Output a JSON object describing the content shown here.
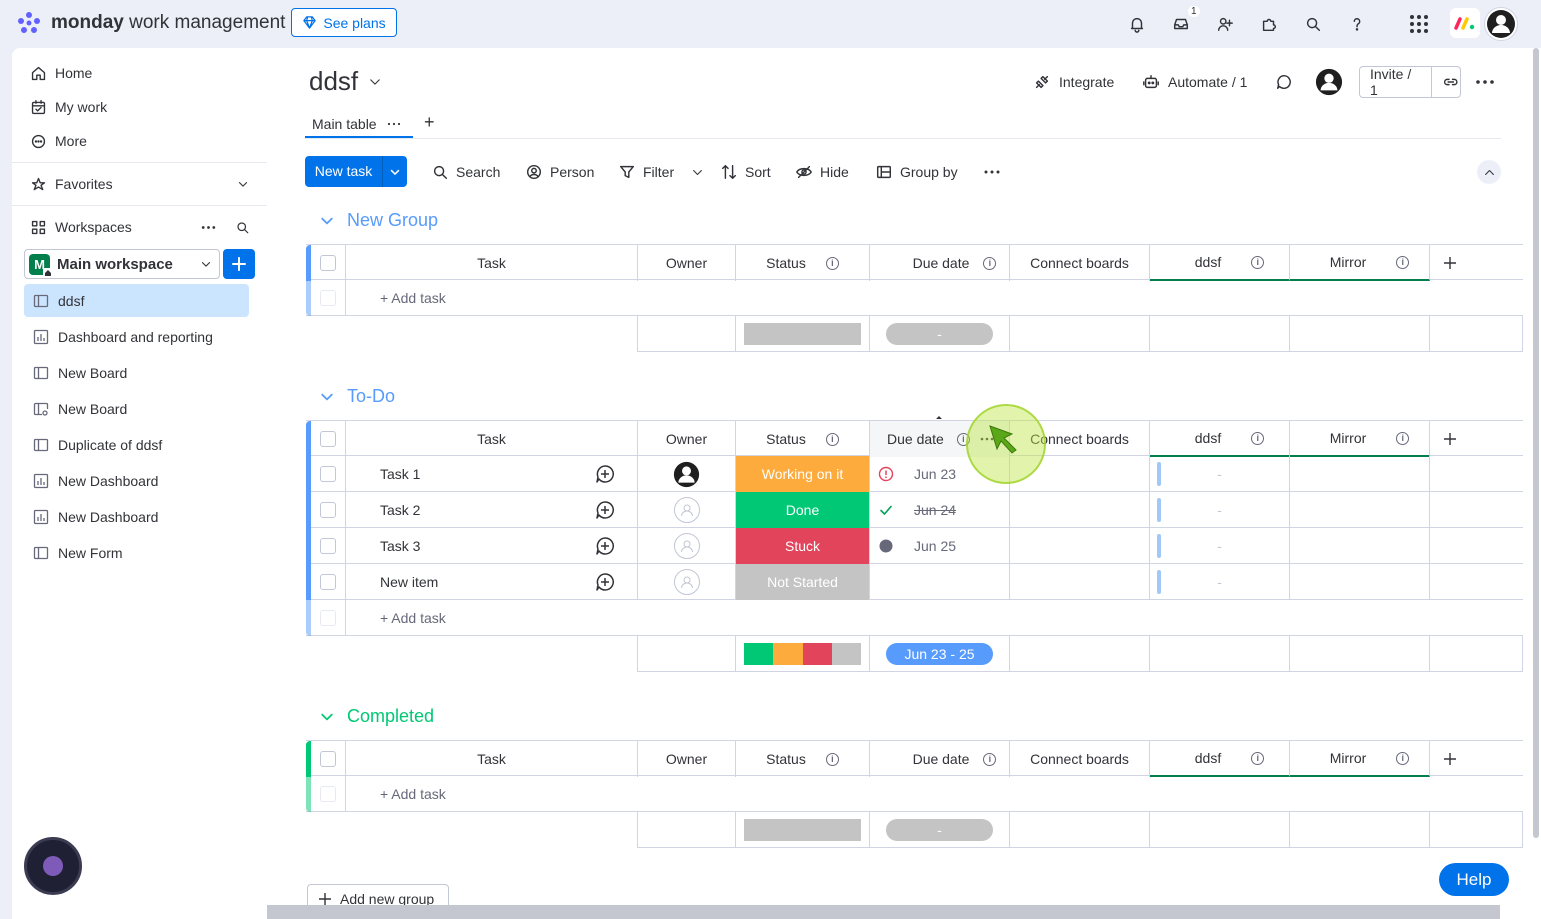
{
  "topbar": {
    "brand_bold": "monday",
    "brand_rest": " work management",
    "see_plans": "See plans",
    "inbox_count": "1",
    "icons": [
      "bell-icon",
      "inbox-icon",
      "invite-members-icon",
      "apps-icon",
      "search-icon",
      "help-icon",
      "app-switcher-icon",
      "monday-logo-icon",
      "avatar-icon"
    ]
  },
  "sidebar": {
    "nav": [
      {
        "label": "Home",
        "icon": "home-icon"
      },
      {
        "label": "My work",
        "icon": "calendar-check-icon"
      },
      {
        "label": "More",
        "icon": "more-circle-icon"
      }
    ],
    "favorites": "Favorites",
    "workspaces": "Workspaces",
    "workspace_badge": "M",
    "workspace_name": "Main workspace",
    "boards": [
      {
        "label": "ddsf",
        "icon": "board-icon",
        "active": true
      },
      {
        "label": "Dashboard and reporting",
        "icon": "dashboard-icon"
      },
      {
        "label": "New Board",
        "icon": "board-icon"
      },
      {
        "label": "New Board",
        "icon": "shared-board-icon"
      },
      {
        "label": "Duplicate of ddsf",
        "icon": "board-icon"
      },
      {
        "label": "New Dashboard",
        "icon": "dashboard-icon"
      },
      {
        "label": "New Dashboard",
        "icon": "dashboard-icon"
      },
      {
        "label": "New Form",
        "icon": "form-icon"
      }
    ]
  },
  "board": {
    "title": "ddsf",
    "tab": "Main table",
    "tab_add": "+",
    "integrate": "Integrate",
    "automate": "Automate / 1",
    "invite": "Invite / 1"
  },
  "toolbar": {
    "new_task": "New task",
    "search": "Search",
    "person": "Person",
    "filter": "Filter",
    "sort": "Sort",
    "hide": "Hide",
    "group_by": "Group by"
  },
  "columns": {
    "task": "Task",
    "owner": "Owner",
    "status": "Status",
    "due_date": "Due date",
    "connect_boards": "Connect boards",
    "ddsf": "ddsf",
    "mirror": "Mirror",
    "info": "i"
  },
  "add_task": "+ Add task",
  "groups": [
    {
      "name": "New Group",
      "color": "#579bfc"
    },
    {
      "name": "To-Do",
      "color": "#579bfc",
      "rows": [
        {
          "task": "Task 1",
          "owner": "assigned",
          "status": "Working on it",
          "status_color": "#fdab3d",
          "date_icon": "overdue-alert-icon",
          "due": "Jun 23",
          "mirror": "-"
        },
        {
          "task": "Task 2",
          "owner": "empty",
          "status": "Done",
          "status_color": "#00c875",
          "date_icon": "done-check-icon",
          "due": "Jun 24",
          "mirror": "-"
        },
        {
          "task": "Task 3",
          "owner": "empty",
          "status": "Stuck",
          "status_color": "#e2445c",
          "date_icon": "upcoming-dot-icon",
          "due": "Jun 25",
          "mirror": "-"
        },
        {
          "task": "New item",
          "owner": "empty",
          "status": "Not Started",
          "status_color": "#c4c4c4",
          "date_icon": "",
          "due": "",
          "mirror": "-"
        }
      ],
      "date_range": "Jun 23 - 25",
      "status_summary": [
        {
          "color": "#00c875",
          "fraction": 0.25
        },
        {
          "color": "#fdab3d",
          "fraction": 0.25
        },
        {
          "color": "#e2445c",
          "fraction": 0.25
        },
        {
          "color": "#c4c4c4",
          "fraction": 0.25
        }
      ]
    },
    {
      "name": "Completed",
      "color": "#00c875"
    }
  ],
  "empty_date_summary": "-",
  "add_group": "Add new group",
  "help": "Help"
}
